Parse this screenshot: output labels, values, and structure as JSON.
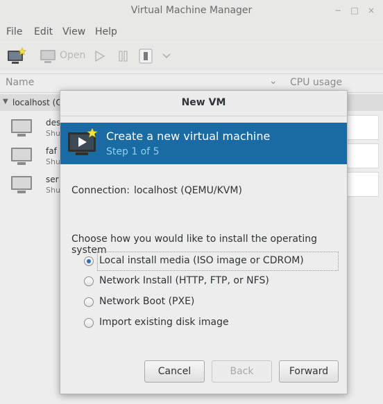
{
  "window": {
    "title": "Virtual Machine Manager",
    "controls": {
      "minimize": "−",
      "maximize": "□",
      "close": "×"
    }
  },
  "menu": {
    "items": [
      "File",
      "Edit",
      "View",
      "Help"
    ]
  },
  "toolbar": {
    "open_label": "Open"
  },
  "columns": {
    "name": "Name",
    "cpu": "CPU usage",
    "sort_indicator": "⌄"
  },
  "host": {
    "label": "localhost (Q",
    "expander": "▼"
  },
  "vms": [
    {
      "name": "des",
      "state": "Shu"
    },
    {
      "name": "faf",
      "state": "Shu"
    },
    {
      "name": "ser",
      "state": "Shu"
    }
  ],
  "dialog": {
    "title": "New VM",
    "banner": {
      "heading": "Create a new virtual machine",
      "step": "Step 1 of 5"
    },
    "connection": {
      "label": "Connection:",
      "value": "localhost (QEMU/KVM)"
    },
    "prompt": "Choose how you would like to install the operating system",
    "options": [
      {
        "label": "Local install media (ISO image or CDROM)",
        "selected": true
      },
      {
        "label": "Network Install (HTTP, FTP, or NFS)",
        "selected": false
      },
      {
        "label": "Network Boot (PXE)",
        "selected": false
      },
      {
        "label": "Import existing disk image",
        "selected": false
      }
    ],
    "buttons": {
      "cancel": "Cancel",
      "back": "Back",
      "forward": "Forward"
    }
  },
  "colors": {
    "banner": "#1a6aa3",
    "banner_step": "#8ed0f2",
    "radio_on": "#2e6db2"
  }
}
